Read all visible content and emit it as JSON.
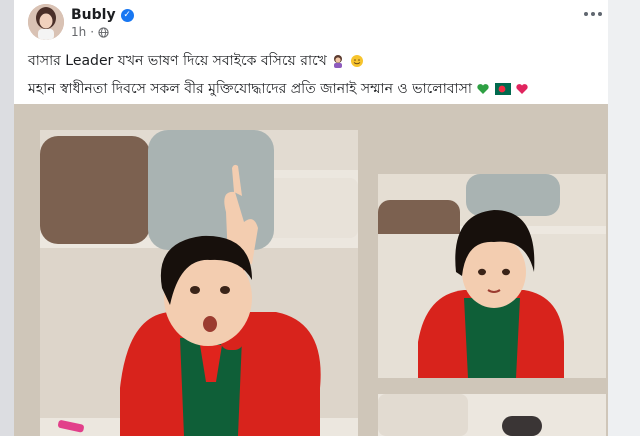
{
  "post": {
    "author": "Bubly",
    "time": "1h",
    "line1": "বাসার Leader যখন ভাষণ দিয়ে সবাইকে বসিয়ে রাখে",
    "line2": "মহান স্বাধীনতা দিবসে সকল বীর মুক্তিযোদ্ধাদের প্রতি জানাই সম্মান ও ভালোবাসা"
  },
  "icons": {
    "verified": "verified-badge-icon",
    "privacy": "globe-icon",
    "menu": "more-options-icon"
  },
  "colors": {
    "brand_blue": "#1877f2",
    "card_bg": "#ffffff",
    "page_bg": "#dcdde1",
    "media_bg": "#cfc6b9",
    "outfit_red": "#d8231c",
    "outfit_green": "#0f5f38"
  }
}
